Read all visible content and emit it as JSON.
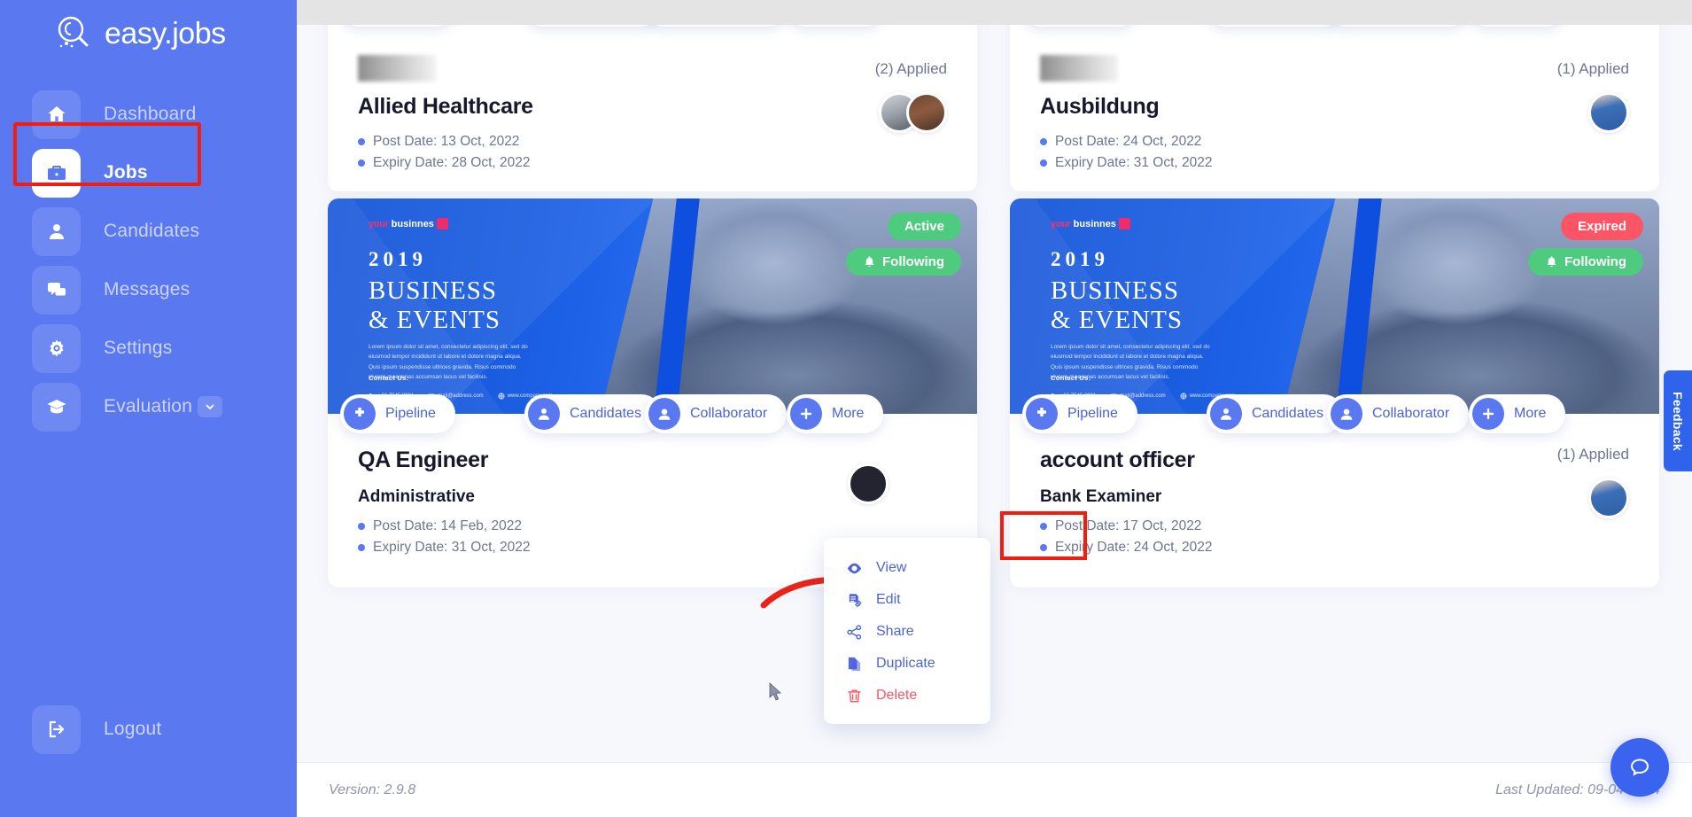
{
  "app": {
    "brand": "easy.jobs"
  },
  "sidebar": {
    "items": [
      {
        "label": "Dashboard",
        "icon": "home-icon",
        "active": false
      },
      {
        "label": "Jobs",
        "icon": "briefcase-icon",
        "active": true
      },
      {
        "label": "Candidates",
        "icon": "user-icon",
        "active": false
      },
      {
        "label": "Messages",
        "icon": "chat-icon",
        "active": false
      },
      {
        "label": "Settings",
        "icon": "gear-icon",
        "active": false
      },
      {
        "label": "Evaluation",
        "icon": "graduation-cap-icon",
        "active": false,
        "chevron": "chevron-down-icon"
      }
    ],
    "logout": {
      "label": "Logout",
      "icon": "logout-icon"
    }
  },
  "banner_poster": {
    "logo_a": "your",
    "logo_b": "businnes",
    "year": "2019",
    "title_line1": "BUSINESS",
    "title_line2": "& EVENTS",
    "body": "Lorem ipsum dolor sit amet, consectetur adipiscing elit, sed do eiusmod tempor incididunt ut labore et dolore magna aliqua. Quis ipsum suspendisse ultrices gravida. Risus commodo viverra maecenas accumsan lacus vel facilisis.",
    "contact_label": "Contact Us:",
    "phone": "+66 7545 8901",
    "email": "mail@address.com",
    "website": "www.company.com"
  },
  "action_buttons": [
    {
      "label": "Pipeline",
      "icon": "pipeline-icon"
    },
    {
      "label": "Candidates",
      "icon": "candidates-icon"
    },
    {
      "label": "Collaborator",
      "icon": "collaborator-icon"
    },
    {
      "label": "More",
      "icon": "plus-icon"
    }
  ],
  "cards_top_row": [
    {
      "title": "Allied Healthcare",
      "post_date_label": "Post Date: 13 Oct, 2022",
      "expiry_date_label": "Expiry Date: 28 Oct, 2022",
      "applied": "(2) Applied"
    },
    {
      "title": "Ausbildung",
      "post_date_label": "Post Date: 24 Oct, 2022",
      "expiry_date_label": "Expiry Date: 31 Oct, 2022",
      "applied": "(1) Applied"
    }
  ],
  "cards_bottom_row": [
    {
      "title": "QA Engineer",
      "subtitle": "Administrative",
      "post_date_label": "Post Date: 14 Feb, 2022",
      "expiry_date_label": "Expiry Date: 31 Oct, 2022",
      "status": "Active",
      "following": "Following",
      "applied": ""
    },
    {
      "title": "account officer",
      "subtitle": "Bank Examiner",
      "post_date_label": "Post Date: 17 Oct, 2022",
      "expiry_date_label": "Expiry Date: 24 Oct, 2022",
      "status": "Expired",
      "following": "Following",
      "applied": "(1) Applied"
    }
  ],
  "dropdown": {
    "items": [
      {
        "label": "View",
        "icon": "eye-icon",
        "danger": false
      },
      {
        "label": "Edit",
        "icon": "edit-pencil-icon",
        "danger": false
      },
      {
        "label": "Share",
        "icon": "share-icon",
        "danger": false
      },
      {
        "label": "Duplicate",
        "icon": "duplicate-icon",
        "danger": false
      },
      {
        "label": "Delete",
        "icon": "trash-icon",
        "danger": true
      }
    ]
  },
  "footer": {
    "version": "Version: 2.9.8",
    "last_updated": "Last Updated: 09-04-2024"
  },
  "feedback": {
    "label": "Feedback"
  },
  "colors": {
    "sidebar": "#5a78f0",
    "accent": "#4a63d8",
    "status_active": "#4ecb7e",
    "status_expired": "#fd5565",
    "following": "#4ecb7e",
    "highlight": "#f51b0e",
    "danger": "#fd5565"
  }
}
